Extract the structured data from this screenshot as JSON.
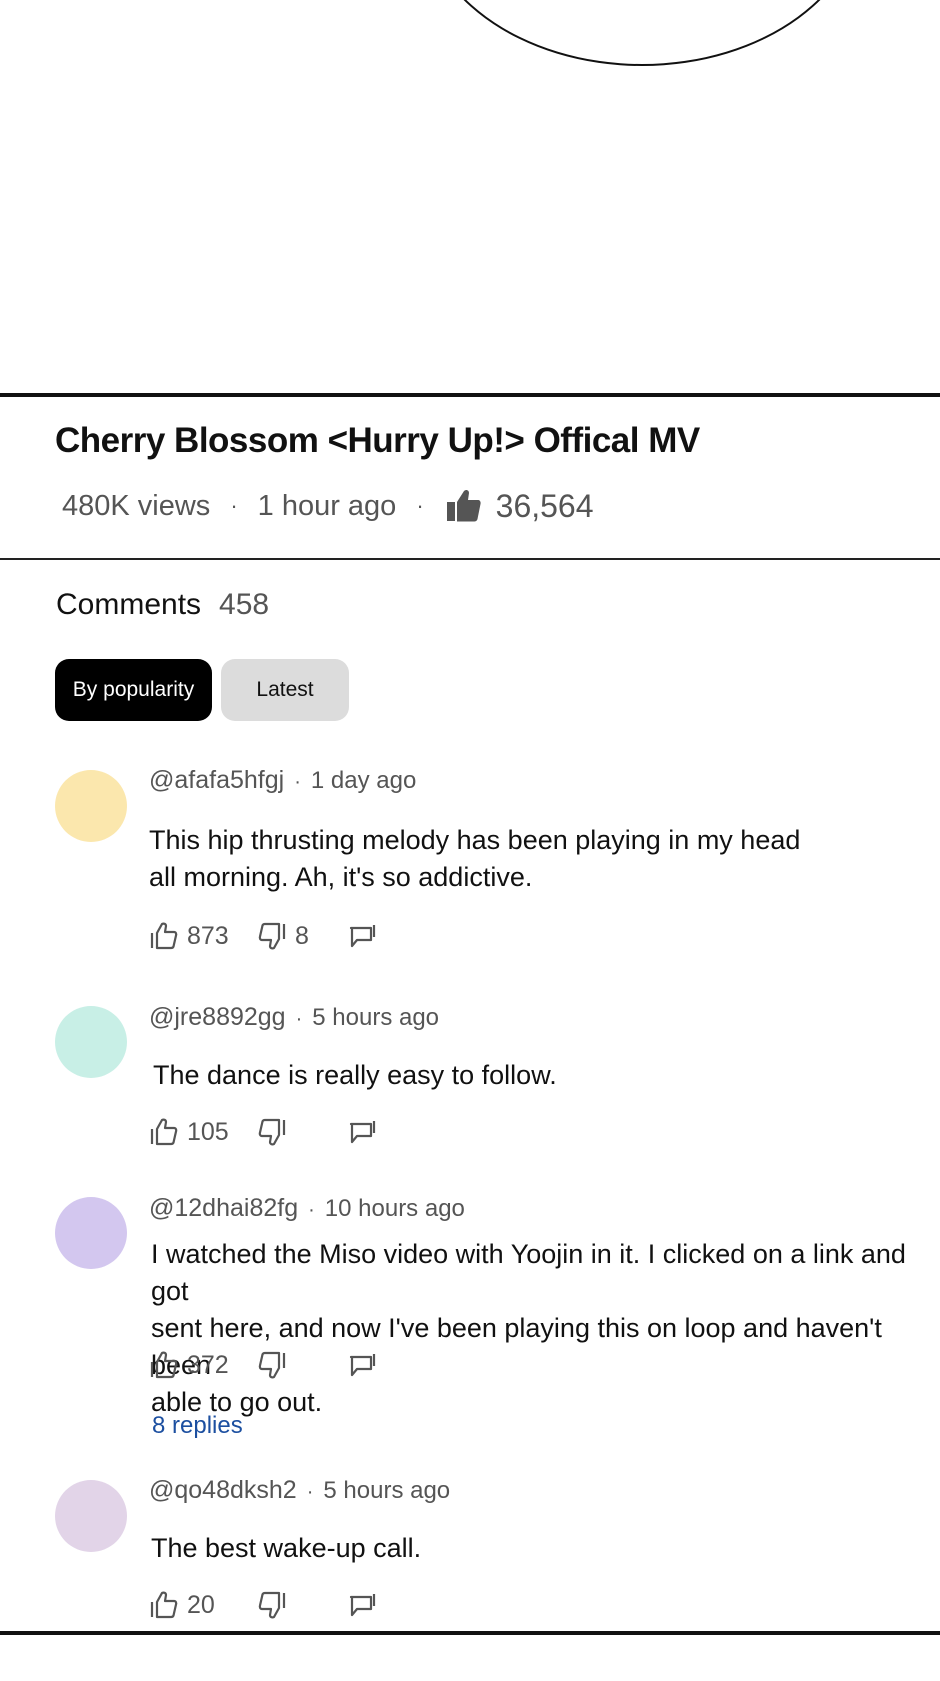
{
  "video": {
    "title": "Cherry Blossom <Hurry Up!> Offical MV",
    "views": "480K views",
    "posted": "1 hour ago",
    "separator": "·",
    "likes": "36,564"
  },
  "comments_section": {
    "label": "Comments",
    "count": "458",
    "sort_tabs": [
      {
        "label": "By popularity",
        "active": true
      },
      {
        "label": "Latest",
        "active": false
      }
    ]
  },
  "comments": [
    {
      "handle": "@afafa5hfgj",
      "time": "1 day ago",
      "text_lines": [
        "This hip thrusting melody has been playing in my head",
        "all morning. Ah, it's so addictive."
      ],
      "likes": "873",
      "dislikes": "8",
      "avatar_color": "#fbe7ad"
    },
    {
      "handle": "@jre8892gg",
      "time": "5 hours ago",
      "text_lines": [
        "The dance is really easy to follow."
      ],
      "likes": "105",
      "dislikes": "",
      "avatar_color": "#c8efe6"
    },
    {
      "handle": "@12dhai82fg",
      "time": "10 hours ago",
      "text_lines": [
        "I watched the Miso video with Yoojin in it. I clicked on a link and got",
        "sent here, and now I've been playing this on loop and haven't been",
        "able to go out."
      ],
      "likes": "372",
      "dislikes": "",
      "replies": "8 replies",
      "avatar_color": "#d3c7ef"
    },
    {
      "handle": "@qo48dksh2",
      "time": "5 hours ago",
      "text_lines": [
        "The best wake-up call."
      ],
      "likes": "20",
      "dislikes": "",
      "avatar_color": "#e2d4e8"
    }
  ],
  "icons": {
    "like": "thumbs-up-icon",
    "dislike": "thumbs-down-icon",
    "reply": "reply-icon",
    "video_like": "thumbs-up-filled-icon"
  },
  "colors": {
    "link": "#1c4fa0",
    "active_tab": "#000000",
    "inactive_tab": "#dcdcdc"
  }
}
